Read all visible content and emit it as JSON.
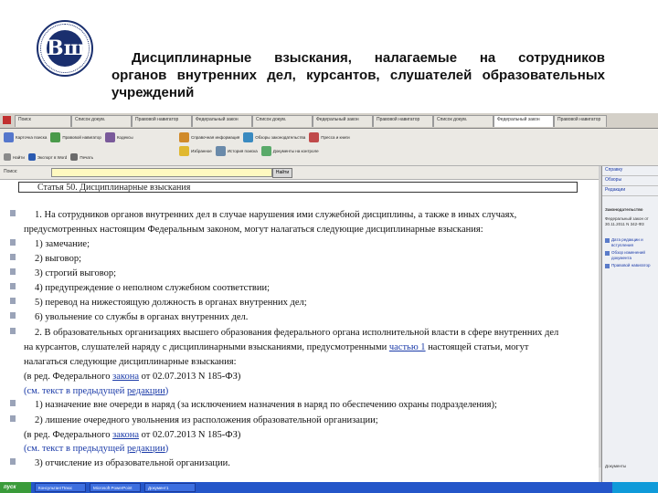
{
  "slide": {
    "title_line1": "Дисциплинарные взыскания, налагаемые на сотрудников",
    "title_line2": "органов внутренних дел, курсантов, слушателей образовательных",
    "title_line3": "учреждений",
    "logo_letters": "Вш"
  },
  "window": {
    "tabs": [
      "Поиск",
      "Список докум.",
      "Правовой навигатор",
      "Федеральный закон",
      "Список докум.",
      "Федеральный закон",
      "Правовой навигатор",
      "Список докум.",
      "Федеральный закон",
      "Правовой навигатор"
    ],
    "toolbar": {
      "buttons_row1": [
        "Карточка поиска",
        "Правовой навигатор",
        "Кодексы",
        "Справочная информация",
        "Обзоры законодательства",
        "Пресса и книги"
      ],
      "buttons_row2": [
        "Избранное",
        "История поиска",
        "Документы на контроле"
      ],
      "find_label": "Найти",
      "export_label": "Экспорт в Word",
      "print_label": "Печать"
    },
    "address": {
      "label": "Поиск:",
      "value": "",
      "go_label": "Найти"
    },
    "document": {
      "article_title": "Статья 50. Дисциплинарные взыскания",
      "paragraphs": [
        "1. На сотрудников органов внутренних дел в случае нарушения ими служебной дисциплины, а также в иных случаях,",
        "предусмотренных настоящим Федеральным законом, могут налагаться следующие дисциплинарные взыскания:",
        "1) замечание;",
        "2) выговор;",
        "3) строгий выговор;",
        "4) предупреждение о неполном служебном соответствии;",
        "5) перевод на нижестоящую должность в органах внутренних дел;",
        "6) увольнение со службы в органах внутренних дел.",
        "2. В образовательных организациях высшего образования федерального органа исполнительной власти в сфере внутренних дел",
        "на курсантов, слушателей наряду с дисциплинарными взысканиями, предусмотренными",
        "частью 1",
        "настоящей статьи, могут",
        "налагаться следующие дисциплинарные взыскания:",
        "(в ред. Федерального",
        "закона",
        "от 02.07.2013 N 185-ФЗ)",
        "(см. текст в предыдущей",
        "редакции",
        ")",
        "1) назначение вне очереди в наряд (за исключением назначения в наряд по обеспечению охраны подразделения);",
        "2) лишение очередного увольнения из расположения образовательной организации;",
        "(в ред. Федерального",
        "закона",
        "от 02.07.2013 N 185-ФЗ)",
        "(см. текст в предыдущей",
        "редакции",
        ")",
        "3) отчисление из образовательной организации."
      ]
    },
    "sidebar": {
      "links_top": [
        "Справку",
        "Обзоры",
        "Редакции"
      ],
      "info_title": "Законодательство",
      "info_text": "Федеральный закон от 30.11.2011 N 342-ФЗ",
      "links": [
        "Дата редакции и вступления",
        "Обзор изменений документа",
        "Правовой навигатор"
      ],
      "bottom": "Документы"
    },
    "taskbar": {
      "start_label": "пуск",
      "tasks": [
        "КонсультантПлюс",
        "Microsoft PowerPoint",
        "Документ1"
      ]
    }
  },
  "colors": {
    "logo_blue": "#1a2f6e",
    "link_blue": "#1a3aa8",
    "taskbar_blue": "#2456c9",
    "start_green": "#3a9b3a"
  }
}
